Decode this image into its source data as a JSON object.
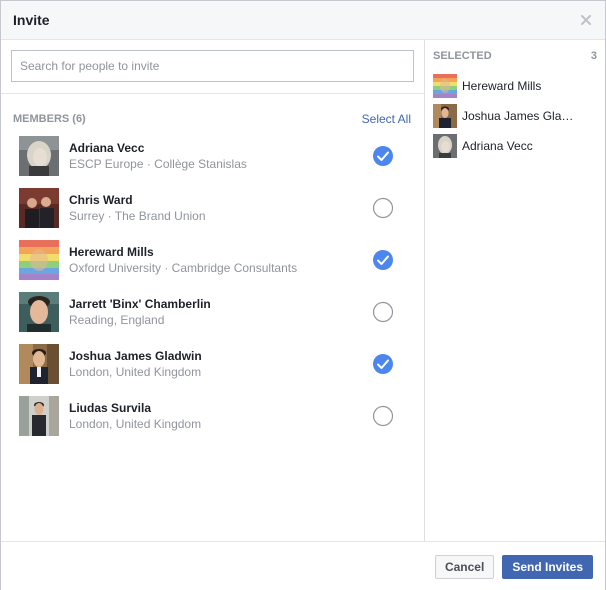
{
  "dialog": {
    "title": "Invite",
    "close_icon": "close-icon"
  },
  "search": {
    "placeholder": "Search for people to invite",
    "value": ""
  },
  "members": {
    "label": "MEMBERS (6)",
    "select_all": "Select All",
    "items": [
      {
        "name": "Adriana Vecc",
        "sub": "ESCP Europe · Collège Stanislas",
        "checked": true
      },
      {
        "name": "Chris Ward",
        "sub": "Surrey · The Brand Union",
        "checked": false
      },
      {
        "name": "Hereward Mills",
        "sub": "Oxford University · Cambridge Consultants",
        "checked": true
      },
      {
        "name": "Jarrett 'Binx' Chamberlin",
        "sub": "Reading, England",
        "checked": false
      },
      {
        "name": "Joshua James Gladwin",
        "sub": "London, United Kingdom",
        "checked": true
      },
      {
        "name": "Liudas Survila",
        "sub": "London, United Kingdom",
        "checked": false
      }
    ]
  },
  "selected": {
    "label": "SELECTED",
    "count": "3",
    "items": [
      {
        "name": "Hereward Mills"
      },
      {
        "name": "Joshua James Gla…"
      },
      {
        "name": "Adriana Vecc"
      }
    ]
  },
  "footer": {
    "cancel_label": "Cancel",
    "send_label": "Send Invites"
  },
  "colors": {
    "accent": "#4267b2",
    "check_fill": "#4e86f0",
    "muted": "#90949c"
  }
}
